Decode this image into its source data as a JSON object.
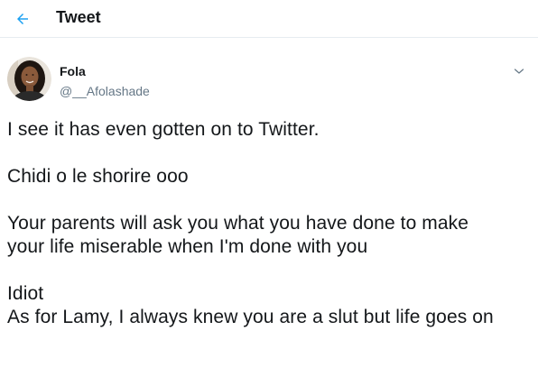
{
  "header": {
    "title": "Tweet",
    "back_icon": "arrow-left-icon",
    "accent_color": "#1da1f2"
  },
  "tweet": {
    "author_name": "Fola",
    "author_handle": "@__Afolashade",
    "avatar_icon": "user-avatar",
    "menu_icon": "chevron-down-icon",
    "lines": [
      "I see it has even gotten on to Twitter.",
      "Chidi o le shorire ooo",
      "Your parents will ask you what you have done to make",
      "your life miserable when I'm done with you",
      "Idiot",
      "As for Lamy, I always knew you are a slut but life goes on"
    ]
  }
}
